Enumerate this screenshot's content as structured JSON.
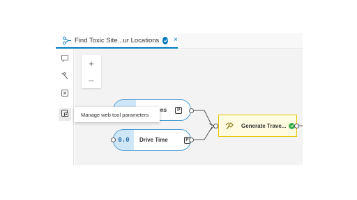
{
  "tab": {
    "title": "Find Toxic Site...ur Locations",
    "tab_icon": "model-icon",
    "status_icon": "check-circle-icon",
    "close_label": "×"
  },
  "toolbar": {
    "items": [
      {
        "name": "connect-tool-icon"
      },
      {
        "name": "hammer-tool-icon"
      },
      {
        "name": "variable-tool-icon"
      },
      {
        "name": "manage-parameters-icon"
      }
    ]
  },
  "zoom": {
    "in_label": "+",
    "out_label": "–"
  },
  "tooltip": {
    "text": "Manage web tool parameters"
  },
  "nodes": {
    "locations": {
      "label": "...ations",
      "param_badge": "P"
    },
    "drive_time": {
      "label": "Drive Time",
      "icon_text": "0.0",
      "param_badge": "P"
    },
    "generate": {
      "label": "Generate Trave...",
      "status_icon": "check-circle-icon"
    }
  },
  "colors": {
    "accent": "#0079c1",
    "input_border": "#4a9cd6",
    "input_fill": "#cfe6f7",
    "tool_border": "#e5c400",
    "tool_fill": "#fffbe0",
    "success": "#35ac46"
  }
}
